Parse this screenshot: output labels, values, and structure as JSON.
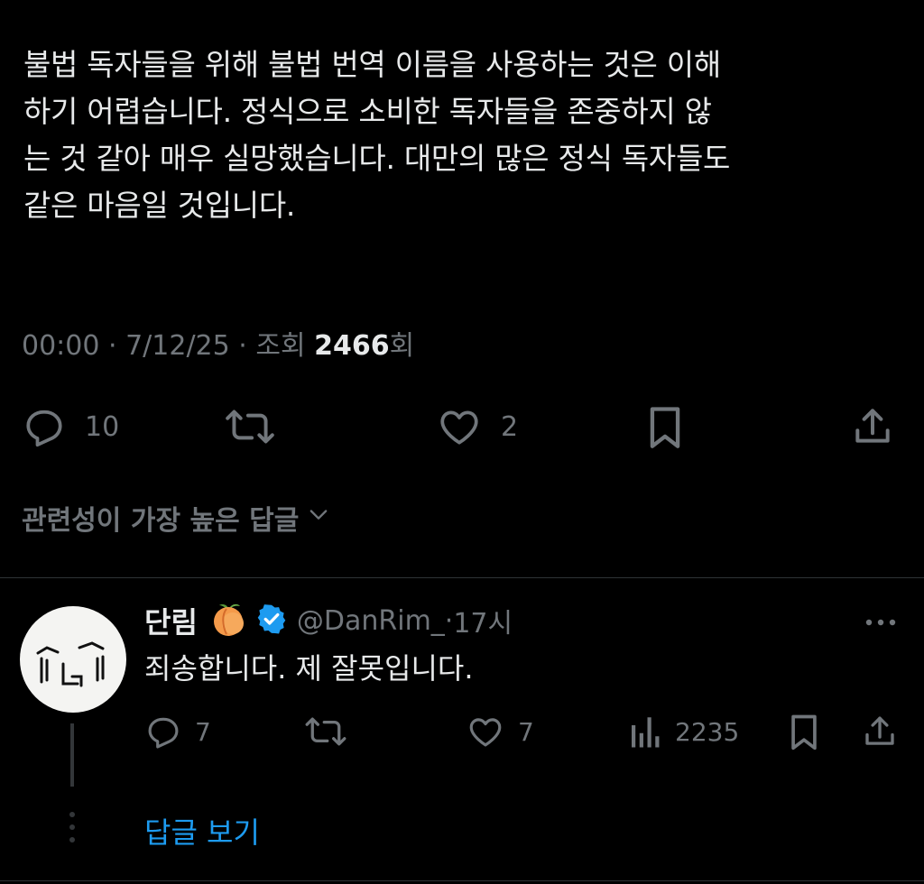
{
  "tweet": {
    "text_lines": [
      "불법 독자들을 위해 불법 번역 이름을 사용하는 것은 이해",
      "하기 어렵습니다. 정식으로 소비한 독자들을 존중하지 않",
      "는 것 같아 매우 실망했습니다. 대만의 많은 정식 독자들도",
      "같은 마음일 것입니다."
    ],
    "time": "00:00",
    "separator": " · ",
    "date": "7/12/25",
    "views_prefix": "조회 ",
    "views_count": "2466",
    "views_suffix": "회",
    "actions": {
      "reply_icon": "reply-bubble-icon",
      "reply_count": "10",
      "retweet_icon": "retweet-icon",
      "like_icon": "heart-icon",
      "like_count": "2",
      "bookmark_icon": "bookmark-icon",
      "share_icon": "share-icon"
    }
  },
  "replies_sort": {
    "label": "관련성이 가장 높은 답글",
    "icon": "chevron-down-icon"
  },
  "reply": {
    "display_name": "단림",
    "emoji_icon": "peach-emoji-icon",
    "verified_icon": "verified-badge-icon",
    "handle": "@DanRim_",
    "time_sep": " · ",
    "time": "17시",
    "text": "죄송합니다. 제 잘못입니다.",
    "more_icon": "more-options-icon",
    "actions": {
      "reply_count": "7",
      "like_count": "7",
      "views_icon": "analytics-icon",
      "views_count": "2235"
    },
    "view_replies_label": "답글 보기"
  },
  "colors": {
    "background": "#000000",
    "text_primary": "#e7e9ea",
    "text_secondary": "#71767b",
    "accent_blue": "#1d9bf0",
    "divider": "#2f3336"
  }
}
